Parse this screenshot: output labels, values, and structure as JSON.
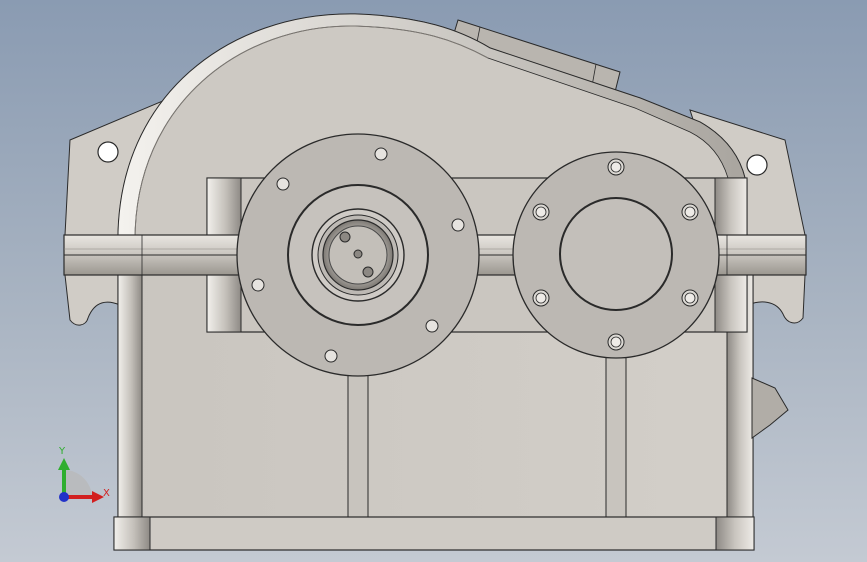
{
  "viewport": {
    "background_top": "#8a9bb2",
    "background_bottom": "#c4cad3"
  },
  "model": {
    "body_color": "#cfcbc5",
    "shade_color": "#8b8782",
    "flange_color": "#bab7b2",
    "edge_color": "#2a2a2a"
  },
  "triad": {
    "x_label": "X",
    "y_label": "Y",
    "x_color": "#d21f1f",
    "y_color": "#2fae2f",
    "z_color": "#2232c8"
  }
}
